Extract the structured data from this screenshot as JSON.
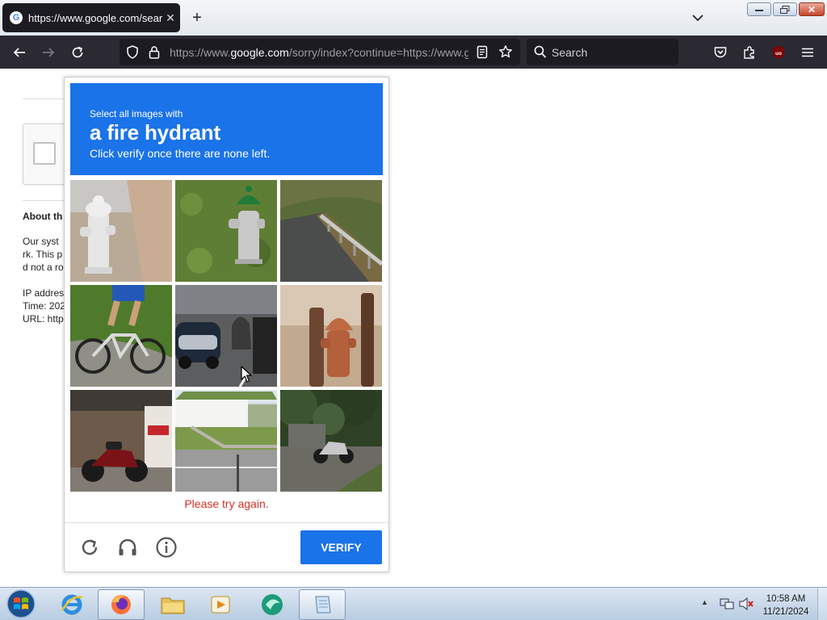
{
  "browser": {
    "tab_title": "https://www.google.com/search",
    "tab_favicon_letter": "G",
    "url_prefix": "https://www.",
    "url_host": "google.com",
    "url_rest": "/sorry/index?continue=https://www.google.com/search",
    "search_placeholder": "Search",
    "addon_badge": "uo"
  },
  "background_page": {
    "about_heading": "About th",
    "lines": [
      "Our syst",
      "rk. This p",
      "d not a ro"
    ],
    "meta_lines": [
      "IP addres",
      "Time: 202",
      "URL: http"
    ]
  },
  "captcha": {
    "instruction_line1": "Select all images with",
    "target": "a fire hydrant",
    "instruction_line3": "Click verify once there are none left.",
    "tiles": [
      {
        "subject": "white fire hydrant on pavement"
      },
      {
        "subject": "green and white fire hydrant in grass"
      },
      {
        "subject": "road guardrail"
      },
      {
        "subject": "cyclist on bicycle"
      },
      {
        "subject": "cars and motorbikes on street"
      },
      {
        "subject": "rusty orange fire hydrant"
      },
      {
        "subject": "motorbike parked by shop"
      },
      {
        "subject": "street with white building"
      },
      {
        "subject": "motorbike under trees"
      }
    ],
    "error_text": "Please try again.",
    "verify_label": "VERIFY"
  },
  "taskbar": {
    "time": "10:58 AM",
    "date": "11/21/2024"
  },
  "colors": {
    "captcha_blue": "#1a73e8",
    "error_red": "#d93025",
    "toolbar_dark": "#2b2a33"
  }
}
